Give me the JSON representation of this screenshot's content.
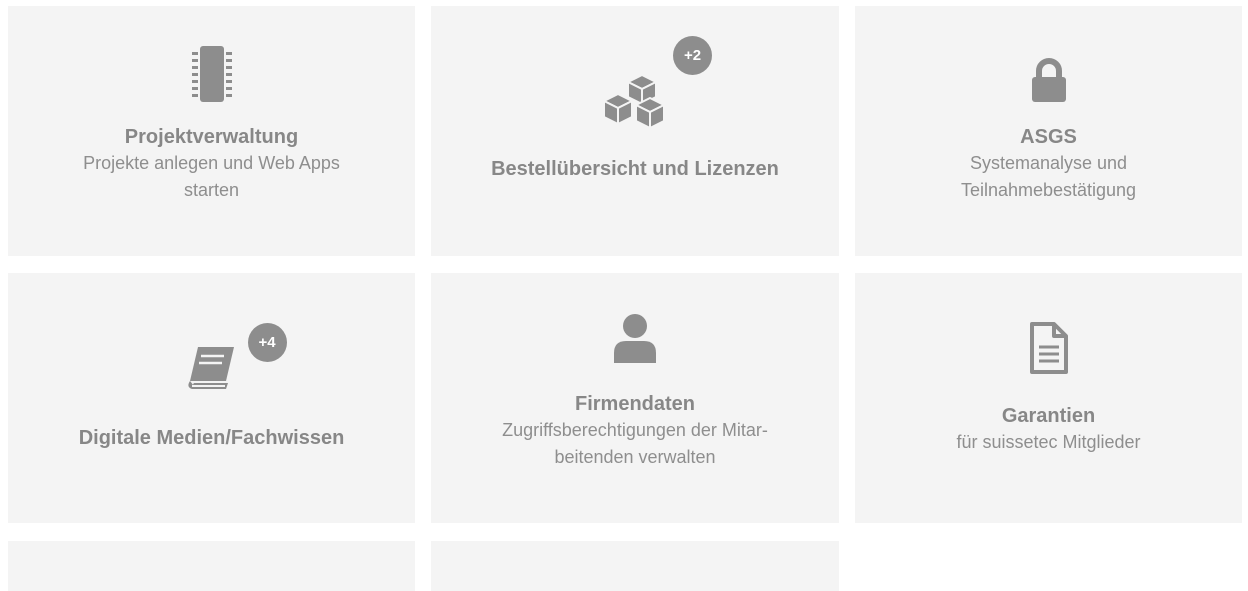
{
  "tiles": [
    {
      "icon": "chip-icon",
      "title": "Projektverwaltung",
      "desc_lines": [
        "Projekte anlegen und Web Apps",
        "starten"
      ]
    },
    {
      "icon": "cubes-icon",
      "badge": "+2",
      "title": "Bestellübersicht und Lizenzen"
    },
    {
      "icon": "lock-icon",
      "title": "ASGS",
      "desc_lines": [
        "Systemanalyse und",
        "Teilnahmebestätigung"
      ]
    },
    {
      "icon": "book-icon",
      "badge": "+4",
      "title": "Digitale Medien/Fachwissen"
    },
    {
      "icon": "user-icon",
      "title": "Firmendaten",
      "desc_lines": [
        "Zugriffsberechtigungen der Mitar-",
        "beitenden verwalten"
      ]
    },
    {
      "icon": "document-icon",
      "title": "Garantien",
      "desc_lines": [
        "für suissetec Mitglieder"
      ]
    }
  ],
  "colors": {
    "tile_bg": "#f4f4f4",
    "text": "#878787",
    "icon": "#8d8d8d",
    "badge_bg": "#8d8d8d",
    "badge_text": "#ffffff"
  }
}
